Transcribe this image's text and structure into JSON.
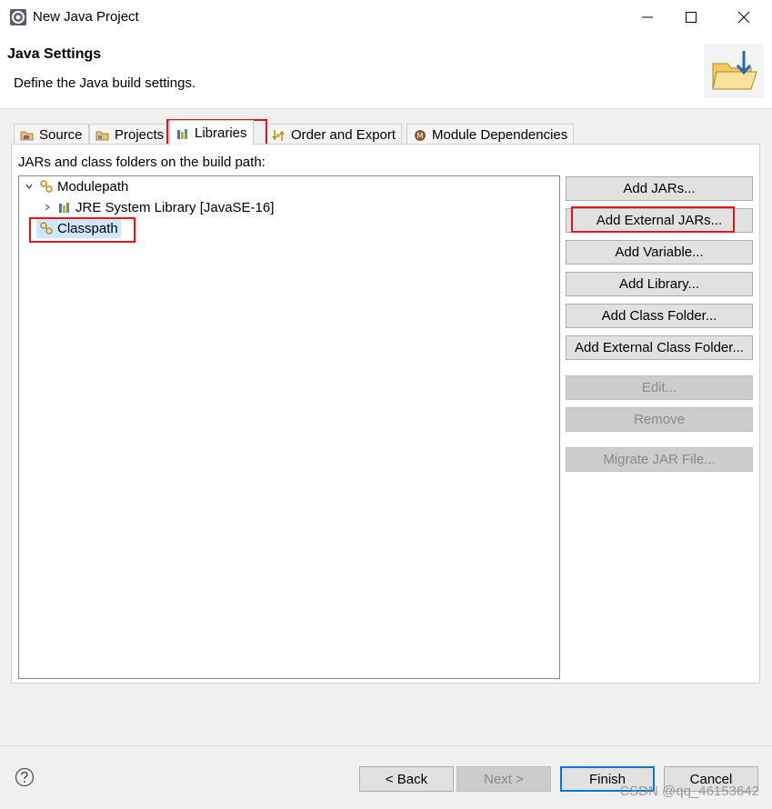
{
  "window": {
    "title": "New Java Project",
    "controls": {
      "minimize": "—",
      "maximize": "☐",
      "close": "✕"
    }
  },
  "header": {
    "title": "Java Settings",
    "description": "Define the Java build settings."
  },
  "tabs": [
    {
      "label": "Source",
      "icon": "source-folder-icon",
      "selected": false
    },
    {
      "label": "Projects",
      "icon": "projects-icon",
      "selected": false
    },
    {
      "label": "Libraries",
      "icon": "libraries-icon",
      "selected": true
    },
    {
      "label": "Order and Export",
      "icon": "order-export-icon",
      "selected": false
    },
    {
      "label": "Module Dependencies",
      "icon": "module-icon",
      "selected": false
    }
  ],
  "libraries": {
    "label": "JARs and class folders on the build path:",
    "tree": {
      "modulepath": {
        "label": "Modulepath",
        "expanded": true
      },
      "jre": {
        "label": "JRE System Library [JavaSE-16]",
        "expanded": false
      },
      "classpath": {
        "label": "Classpath",
        "selected": true
      }
    },
    "buttons": {
      "add_jars": {
        "label": "Add JARs...",
        "enabled": true
      },
      "add_external_jars": {
        "label": "Add External JARs...",
        "enabled": true
      },
      "add_variable": {
        "label": "Add Variable...",
        "enabled": true
      },
      "add_library": {
        "label": "Add Library...",
        "enabled": true
      },
      "add_class_folder": {
        "label": "Add Class Folder...",
        "enabled": true
      },
      "add_external_class_folder": {
        "label": "Add External Class Folder...",
        "enabled": true
      },
      "edit": {
        "label": "Edit...",
        "enabled": false
      },
      "remove": {
        "label": "Remove",
        "enabled": false
      },
      "migrate_jar": {
        "label": "Migrate JAR File...",
        "enabled": false
      }
    }
  },
  "footer": {
    "back": "< Back",
    "next": "Next >",
    "finish": "Finish",
    "cancel": "Cancel"
  },
  "watermark": "CSDN @qq_46153642",
  "colors": {
    "highlight": "#e0161e",
    "default_button_border": "#0078d7",
    "selection": "#cce8ff"
  }
}
